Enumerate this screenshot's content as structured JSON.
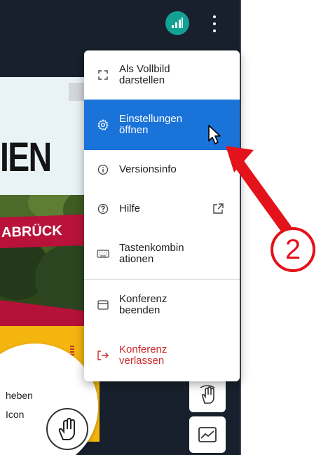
{
  "slide": {
    "headline": "IEN",
    "banner": "ABRÜCK"
  },
  "tooltip": {
    "line1": "heben",
    "line2": "Icon"
  },
  "menu": {
    "items": [
      {
        "label": "Als Vollbild\ndarstellen",
        "icon": "fullscreen-icon"
      },
      {
        "label": "Einstellungen\nöffnen",
        "icon": "gear-icon"
      },
      {
        "label": "Versionsinfo",
        "icon": "info-icon"
      },
      {
        "label": "Hilfe",
        "icon": "help-icon",
        "trailing_icon": "external-link-icon"
      },
      {
        "label": "Tastenkombin\nationen",
        "icon": "keyboard-icon"
      },
      {
        "label": "Konferenz\nbeenden",
        "icon": "window-icon"
      },
      {
        "label": "Konferenz\nverlassen",
        "icon": "leave-icon"
      }
    ]
  },
  "annotation": {
    "step_number": "2",
    "color": "#e3121b"
  },
  "colors": {
    "app_background": "#17202c",
    "menu_active": "#1a73d9",
    "signal_badge": "#13a193",
    "danger_text": "#cc2a2a"
  }
}
